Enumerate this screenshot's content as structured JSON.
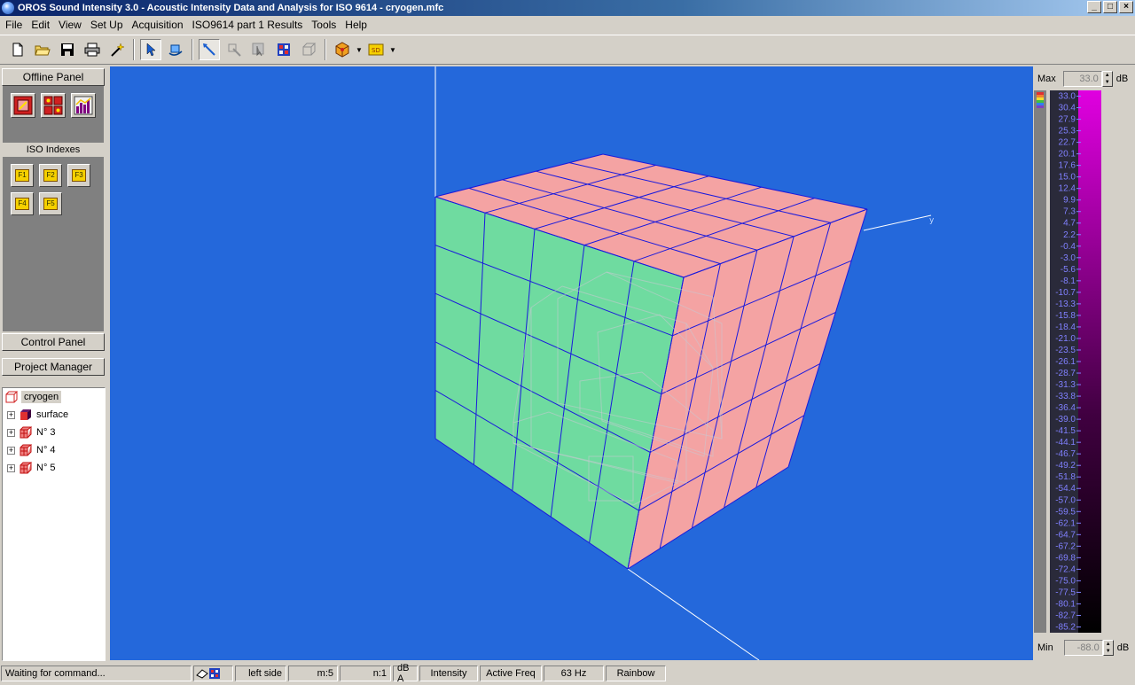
{
  "window": {
    "title": "OROS Sound Intensity 3.0 - Acoustic Intensity Data and Analysis for ISO 9614 - cryogen.mfc",
    "min_label": "_",
    "max_label": "□",
    "close_label": "×"
  },
  "menu": [
    "File",
    "Edit",
    "View",
    "Set Up",
    "Acquisition",
    "ISO9614 part 1 Results",
    "Tools",
    "Help"
  ],
  "toolbar": {
    "icons": [
      "new-file-icon",
      "open-folder-icon",
      "save-icon",
      "print-icon",
      "magic-wand-icon",
      "select-arrow-icon",
      "rotate-view-icon",
      "probe-pointer-icon",
      "move-disabled-icon",
      "cursor-disabled-icon",
      "grid-colour-icon",
      "cube-outline-icon",
      "box-colour-icon",
      "sd-display-icon"
    ]
  },
  "left_panel": {
    "offline_title": "Offline Panel",
    "iso_title": "ISO Indexes",
    "iso_buttons": [
      "F1",
      "F2",
      "F3",
      "F4",
      "F5"
    ],
    "control_title": "Control Panel",
    "project_title": "Project Manager",
    "tree": {
      "root": "cryogen",
      "children": [
        "surface",
        "N° 3",
        "N° 4",
        "N° 5"
      ]
    }
  },
  "viewport": {
    "background": "#2468db",
    "face_front_color": "#6fdba0",
    "face_top_color": "#f4a3a3",
    "face_side_color": "#f4a3a3",
    "grid_color": "#1a1adc",
    "axis_label_y": "y"
  },
  "scale": {
    "max_label": "Max",
    "max_value": "33.0",
    "min_label": "Min",
    "min_value": "-88.0",
    "unit": "dB",
    "ticks": [
      "33.0",
      "30.4",
      "27.9",
      "25.3",
      "22.7",
      "20.1",
      "17.6",
      "15.0",
      "12.4",
      "9.9",
      "7.3",
      "4.7",
      "2.2",
      "-0.4",
      "-3.0",
      "-5.6",
      "-8.1",
      "-10.7",
      "-13.3",
      "-15.8",
      "-18.4",
      "-21.0",
      "-23.5",
      "-26.1",
      "-28.7",
      "-31.3",
      "-33.8",
      "-36.4",
      "-39.0",
      "-41.5",
      "-44.1",
      "-46.7",
      "-49.2",
      "-51.8",
      "-54.4",
      "-57.0",
      "-59.5",
      "-62.1",
      "-64.7",
      "-67.2",
      "-69.8",
      "-72.4",
      "-75.0",
      "-77.5",
      "-80.1",
      "-82.7",
      "-85.2"
    ],
    "palette": "Rainbow"
  },
  "status": {
    "message": "Waiting for command...",
    "side": "left side",
    "m": "m:5",
    "n": "n:1",
    "weighting": "dB A",
    "quantity": "Intensity",
    "freq_mode": "Active Freq",
    "freq": "63 Hz",
    "palette": "Rainbow"
  }
}
